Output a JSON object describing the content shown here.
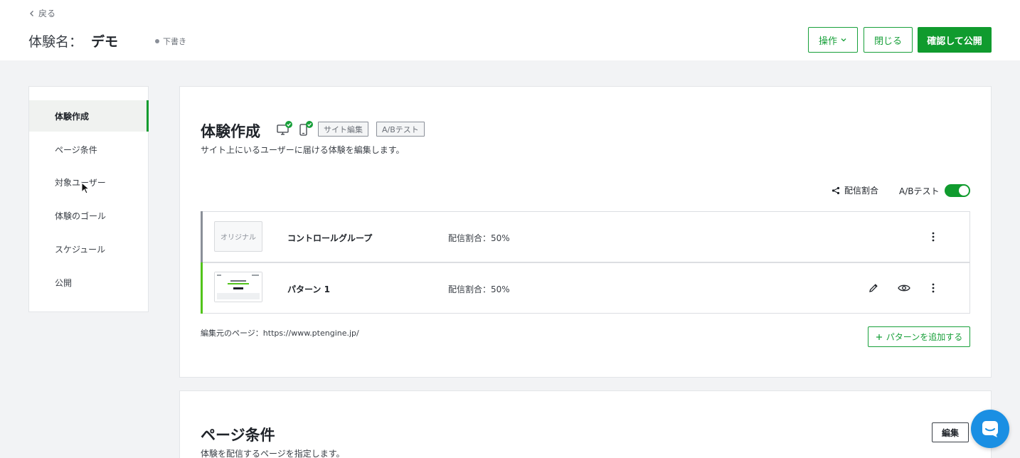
{
  "header": {
    "back_label": "戻る",
    "title_label": "体験名：",
    "title_name": "デモ",
    "status": "下書き",
    "operations_label": "操作",
    "close_label": "閉じる",
    "publish_label": "確認して公開"
  },
  "sidebar": {
    "items": [
      {
        "label": "体験作成"
      },
      {
        "label": "ページ条件"
      },
      {
        "label": "対象ユーザー"
      },
      {
        "label": "体験のゴール"
      },
      {
        "label": "スケジュール"
      },
      {
        "label": "公開"
      }
    ]
  },
  "experience": {
    "title": "体験作成",
    "tags": [
      "サイト編集",
      "A/Bテスト"
    ],
    "subtitle": "サイト上にいるユーザーに届ける体験を編集します。",
    "ratio_link": "配信割合",
    "ab_label": "A/Bテスト",
    "ab_enabled": true,
    "variants": [
      {
        "thumb_label": "オリジナル",
        "name": "コントロールグループ",
        "ratio": "配信割合：50%",
        "accent": "#8a8f98"
      },
      {
        "thumb_label": "",
        "name": "パターン 1",
        "ratio": "配信割合：50%",
        "accent": "#52c41a"
      }
    ],
    "source": "編集元のページ：https://www.ptengine.jp/",
    "add_label": "パターンを追加する"
  },
  "page_conditions": {
    "title": "ページ条件",
    "subtitle": "体験を配信するページを指定します。",
    "edit_label": "編集"
  },
  "colors": {
    "accent": "#109b2e",
    "chat": "#1a8fe3"
  }
}
